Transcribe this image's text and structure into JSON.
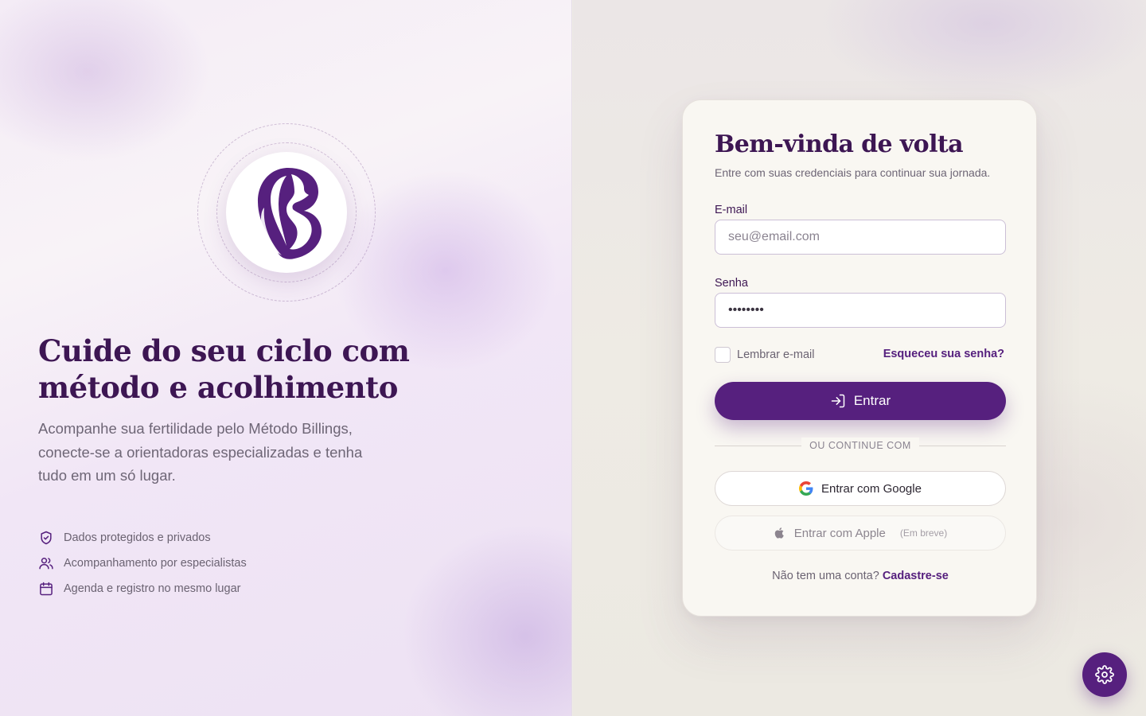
{
  "hero": {
    "title": "Cuide do seu ciclo com método e acolhimento",
    "subtitle": "Acompanhe sua fertilidade pelo Método Billings, conecte-se a orientadoras especializadas e tenha tudo em um só lugar.",
    "features": [
      {
        "icon": "shield-check-icon",
        "label": "Dados protegidos e privados"
      },
      {
        "icon": "users-icon",
        "label": "Acompanhamento por especialistas"
      },
      {
        "icon": "calendar-icon",
        "label": "Agenda e registro no mesmo lugar"
      }
    ]
  },
  "login": {
    "title": "Bem-vinda de volta",
    "subtitle": "Entre com suas credenciais para continuar sua jornada.",
    "email_label": "E-mail",
    "email_placeholder": "seu@email.com",
    "password_label": "Senha",
    "password_value": "password",
    "remember_label": "Lembrar e-mail",
    "forgot_label": "Esqueceu sua senha?",
    "submit_label": "Entrar",
    "divider_text": "OU CONTINUE COM",
    "google_label": "Entrar com Google",
    "apple_label": "Entrar com Apple",
    "apple_soon": "(Em breve)",
    "signup_prompt": "Não tem uma conta?",
    "signup_link": "Cadastre-se"
  },
  "colors": {
    "brand": "#56207e",
    "heading": "#3d1653"
  },
  "fab": {
    "icon": "settings-gear-icon"
  }
}
